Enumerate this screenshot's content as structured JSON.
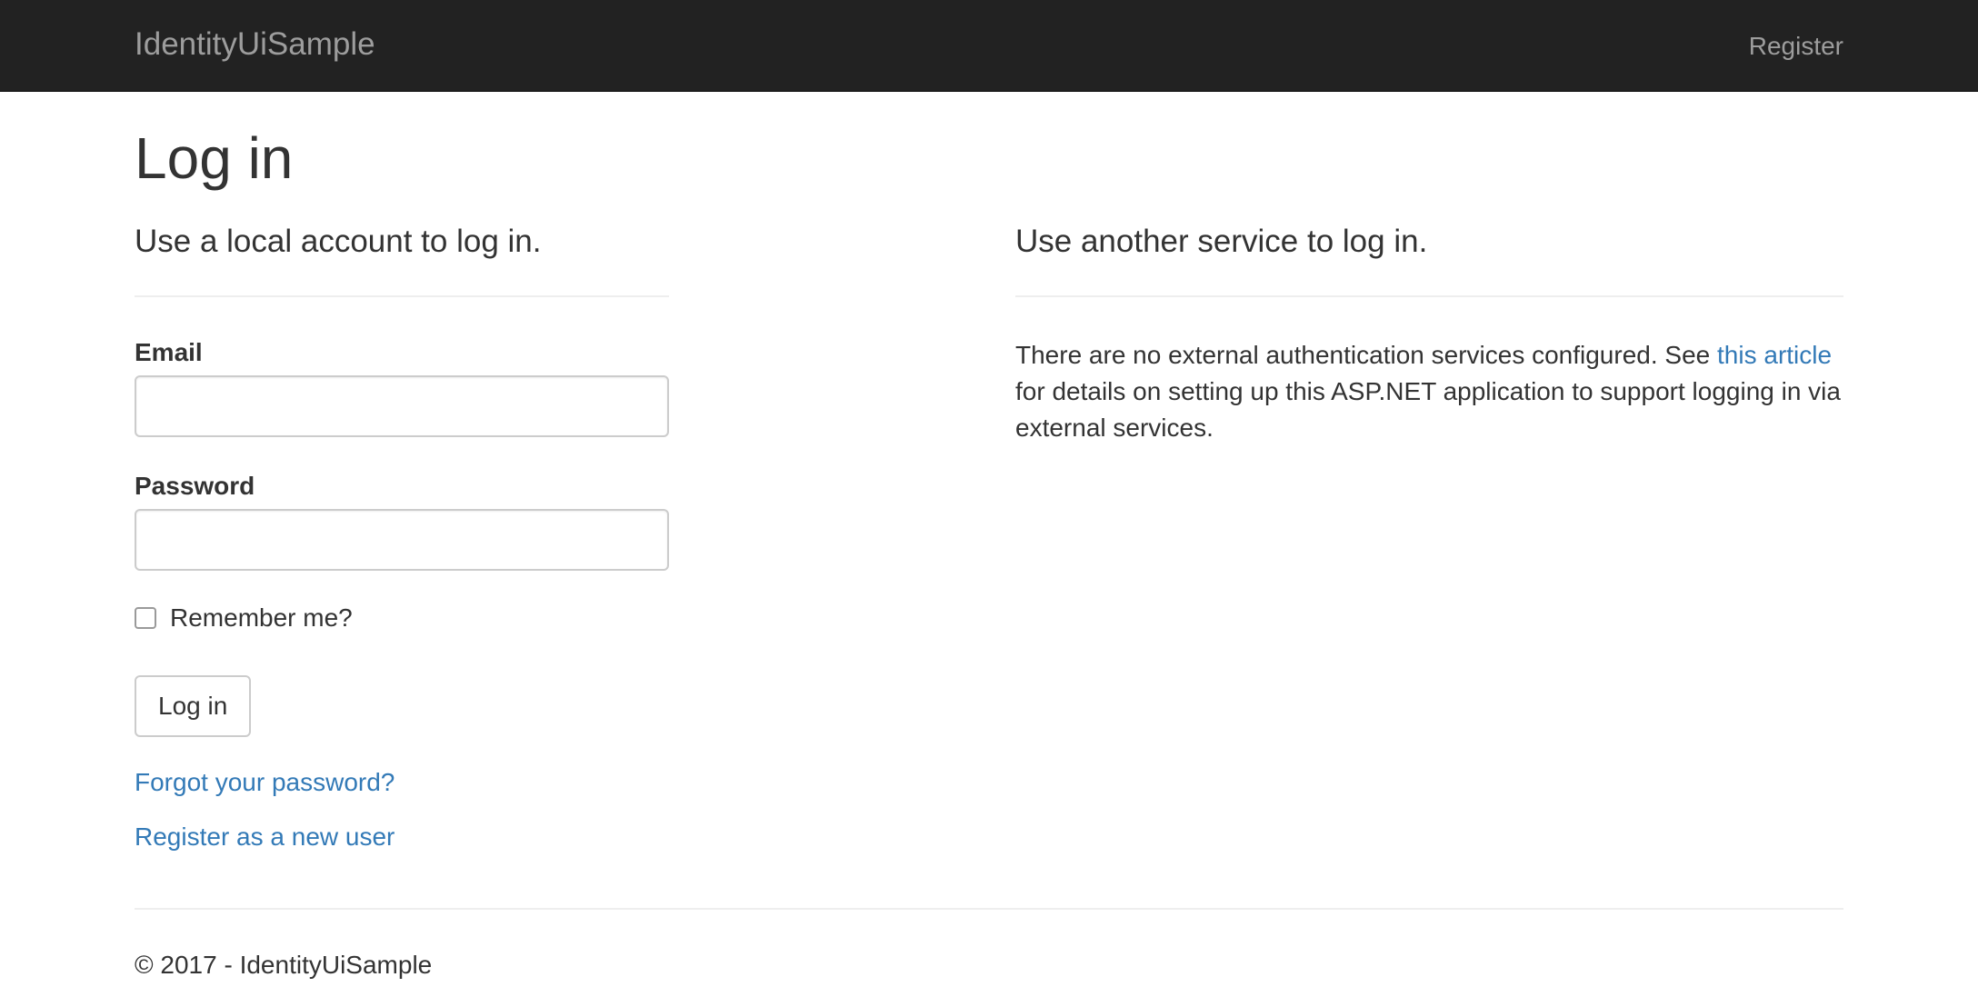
{
  "navbar": {
    "brand": "IdentityUiSample",
    "register": "Register"
  },
  "page_title": "Log in",
  "local": {
    "heading": "Use a local account to log in.",
    "email_label": "Email",
    "email_value": "",
    "password_label": "Password",
    "password_value": "",
    "remember_label": "Remember me?",
    "remember_checked": false,
    "login_button": "Log in",
    "forgot_link": "Forgot your password?",
    "register_link": "Register as a new user"
  },
  "external": {
    "heading": "Use another service to log in.",
    "text_before": "There are no external authentication services configured. See ",
    "link_text": "this article",
    "text_after": " for details on setting up this ASP.NET application to support logging in via external services."
  },
  "footer": {
    "text": "© 2017 - IdentityUiSample"
  },
  "colors": {
    "navbar_bg": "#222222",
    "nav_text": "#9d9d9d",
    "link": "#337ab7",
    "text": "#333333",
    "border": "#cccccc",
    "divider": "#eeeeee"
  }
}
